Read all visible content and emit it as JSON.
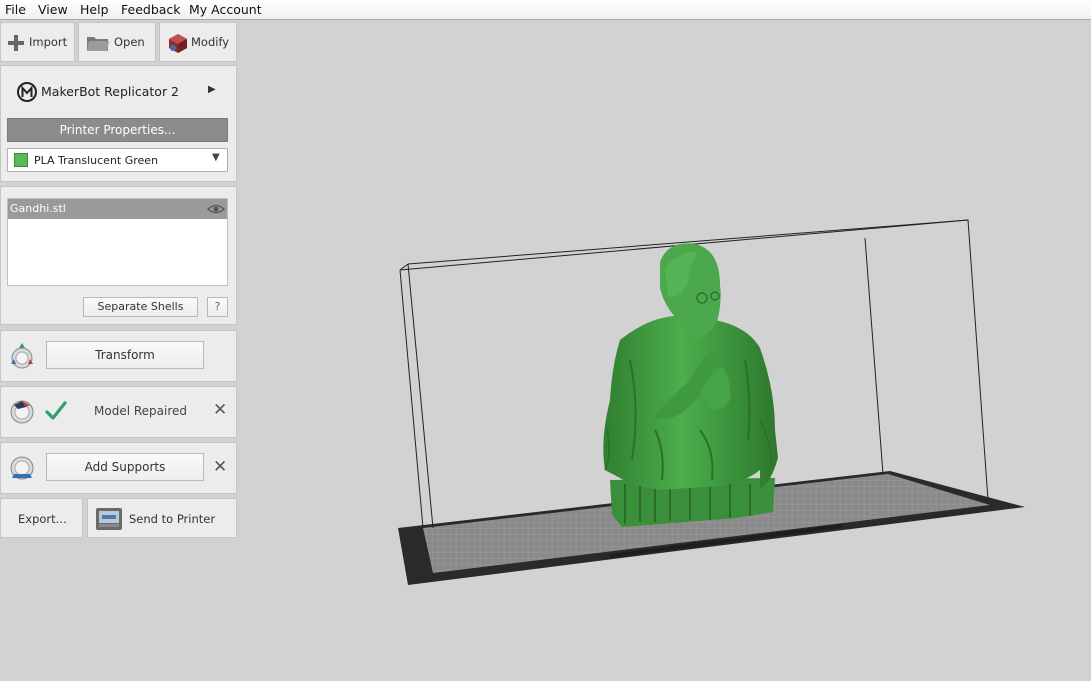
{
  "menu": [
    "File",
    "View",
    "Help",
    "Feedback",
    "My Account"
  ],
  "toolbar": {
    "import_label": "Import",
    "open_label": "Open",
    "modify_label": "Modify"
  },
  "printer": {
    "name": "MakerBot Replicator 2",
    "properties_label": "Printer Properties...",
    "material": "PLA Translucent Green",
    "material_color": "#5cb85c"
  },
  "objects": {
    "items": [
      "Gandhi.stl"
    ],
    "separate_shells_label": "Separate Shells",
    "help_label": "?"
  },
  "operations": {
    "transform_label": "Transform",
    "repair_label": "Model Repaired",
    "supports_label": "Add Supports"
  },
  "actions": {
    "export_label": "Export...",
    "send_label": "Send to Printer"
  },
  "colors": {
    "model": "#3f9a3f",
    "background": "#d2d2d2",
    "accent_check": "#2fa06a"
  }
}
